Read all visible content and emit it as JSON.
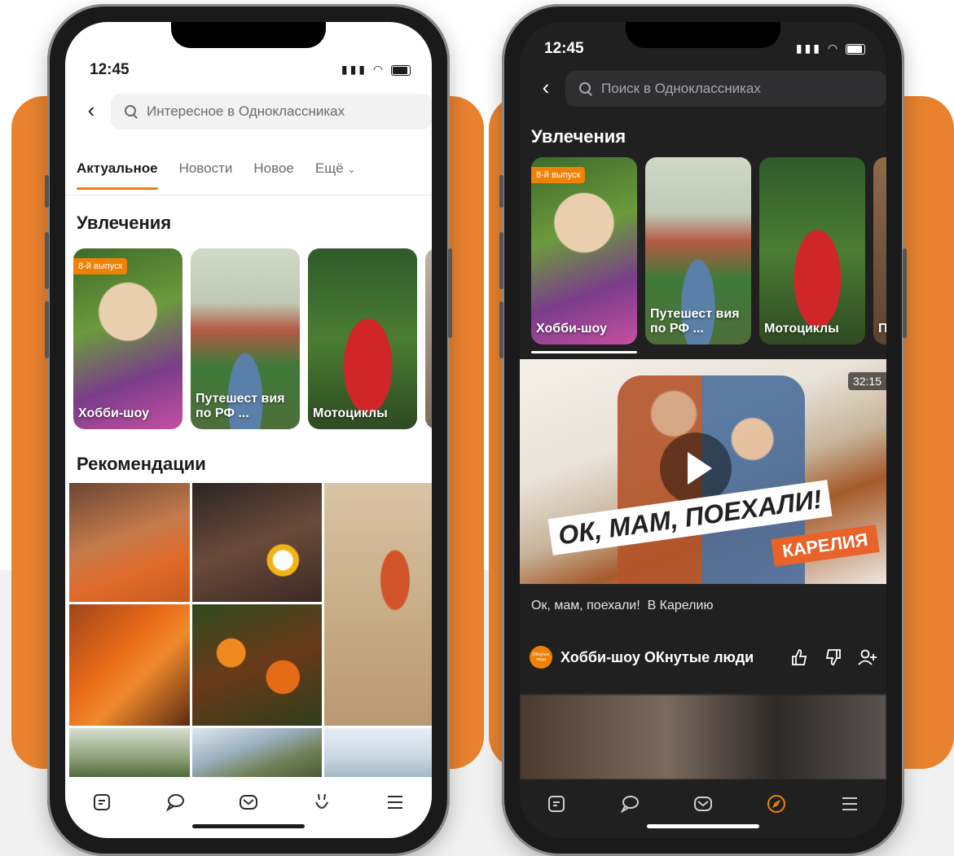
{
  "phone_light": {
    "time": "12:45",
    "search_placeholder": "Интересное в Одноклассниках",
    "tabs": [
      "Актуальное",
      "Новости",
      "Новое",
      "Ещё"
    ],
    "section_hobbies": "Увлечения",
    "badge": "8-й выпуск",
    "cards": [
      "Хобби-шоу",
      "Путешест вия по РФ ...",
      "Мотоциклы"
    ],
    "section_recommendations": "Рекомендации",
    "nav": [
      "feed-icon",
      "chat-icon",
      "mail-icon",
      "bunny-icon",
      "menu-icon"
    ]
  },
  "phone_dark": {
    "time": "12:45",
    "search_placeholder": "Поиск в Одноклассниках",
    "section_hobbies": "Увлечения",
    "badge": "8-й выпуск",
    "cards": [
      "Хобби-шоу",
      "Путешест вия по РФ ...",
      "Мотоциклы",
      "П"
    ],
    "video_duration": "32:15",
    "video_title_line1": "ОК, МАМ, ПОЕХАЛИ!",
    "video_title_line2": "КАРЕЛИЯ",
    "caption": "Ок, мам, поехали!  В Карелию",
    "channel_name": "Хобби-шоу ОКнутые люди",
    "channel_avatar_text": "ОКнутые люди",
    "nav": [
      "feed-icon",
      "chat-icon",
      "mail-icon",
      "compass-icon",
      "menu-icon"
    ]
  },
  "colors": {
    "accent": "#ee8208",
    "background_orange": "#e8822f",
    "dark_screen": "#202021"
  }
}
